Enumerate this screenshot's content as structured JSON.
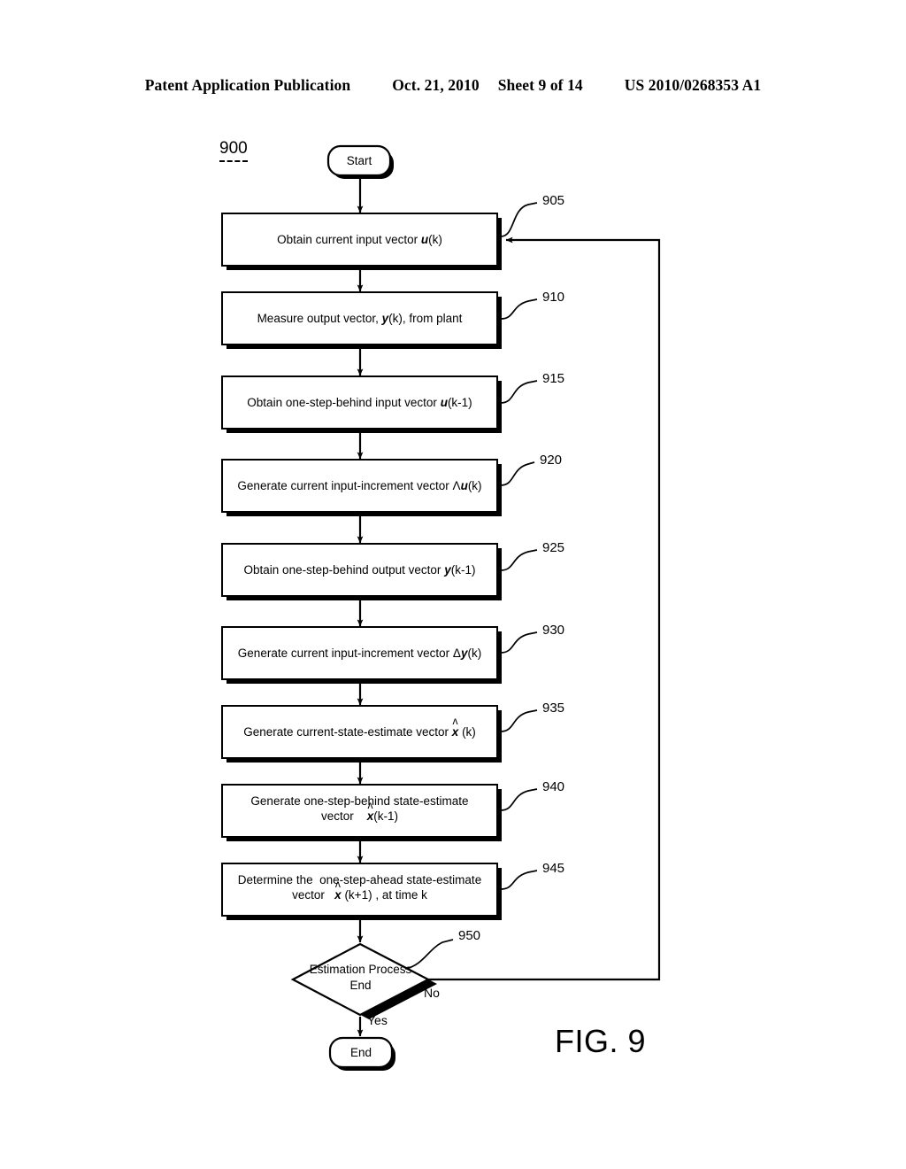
{
  "header": {
    "publication": "Patent Application Publication",
    "date": "Oct. 21, 2010",
    "sheet": "Sheet 9 of 14",
    "patent_number": "US 2010/0268353 A1"
  },
  "figure": {
    "caption": "FIG. 9",
    "diagram_number": "900",
    "start_label": "Start",
    "end_label": "End",
    "decision": {
      "ref": "950",
      "line1": "Estimation Process",
      "line2": "End",
      "yes_label": "Yes",
      "no_label": "No"
    },
    "steps": [
      {
        "ref": "905",
        "text_parts": [
          {
            "t": "Obtain current input vector "
          },
          {
            "t": "u",
            "style": "vec"
          },
          {
            "t": "(k)"
          }
        ]
      },
      {
        "ref": "910",
        "text_parts": [
          {
            "t": "Measure output vector, "
          },
          {
            "t": "y",
            "style": "vec"
          },
          {
            "t": "(k), from plant"
          }
        ]
      },
      {
        "ref": "915",
        "text_parts": [
          {
            "t": "Obtain one-step-behind input vector "
          },
          {
            "t": "u",
            "style": "vec"
          },
          {
            "t": "(k-1)"
          }
        ]
      },
      {
        "ref": "920",
        "text_parts": [
          {
            "t": "Generate current input-increment vector Λ"
          },
          {
            "t": "u",
            "style": "vec"
          },
          {
            "t": "(k)"
          }
        ]
      },
      {
        "ref": "925",
        "text_parts": [
          {
            "t": "Obtain one-step-behind output vector "
          },
          {
            "t": "y",
            "style": "vec"
          },
          {
            "t": "(k-1)"
          }
        ]
      },
      {
        "ref": "930",
        "text_parts": [
          {
            "t": "Generate current input-increment vector Δ"
          },
          {
            "t": "y",
            "style": "vec"
          },
          {
            "t": "(k)"
          }
        ]
      },
      {
        "ref": "935",
        "text_parts": [
          {
            "t": "Generate current-state-estimate vector "
          },
          {
            "t": "x",
            "style": "vec-hat",
            "hat": "ʌ"
          },
          {
            "t": " (k)"
          }
        ]
      },
      {
        "ref": "940",
        "text_parts": [
          {
            "t": "Generate one-step-behind state-estimate"
          },
          {
            "t": "\n"
          },
          {
            "t": "vector    "
          },
          {
            "t": "x",
            "style": "vec-hat",
            "hat": "ʌ"
          },
          {
            "t": "(k-1)"
          }
        ]
      },
      {
        "ref": "945",
        "text_parts": [
          {
            "t": "Determine the  one-step-ahead state-estimate"
          },
          {
            "t": "\n"
          },
          {
            "t": "vector   "
          },
          {
            "t": "x",
            "style": "vec-hat",
            "hat": "ʌ"
          },
          {
            "t": " (k+1) , at time k"
          }
        ]
      }
    ]
  },
  "colors": {
    "ink": "#000000",
    "paper": "#ffffff"
  }
}
